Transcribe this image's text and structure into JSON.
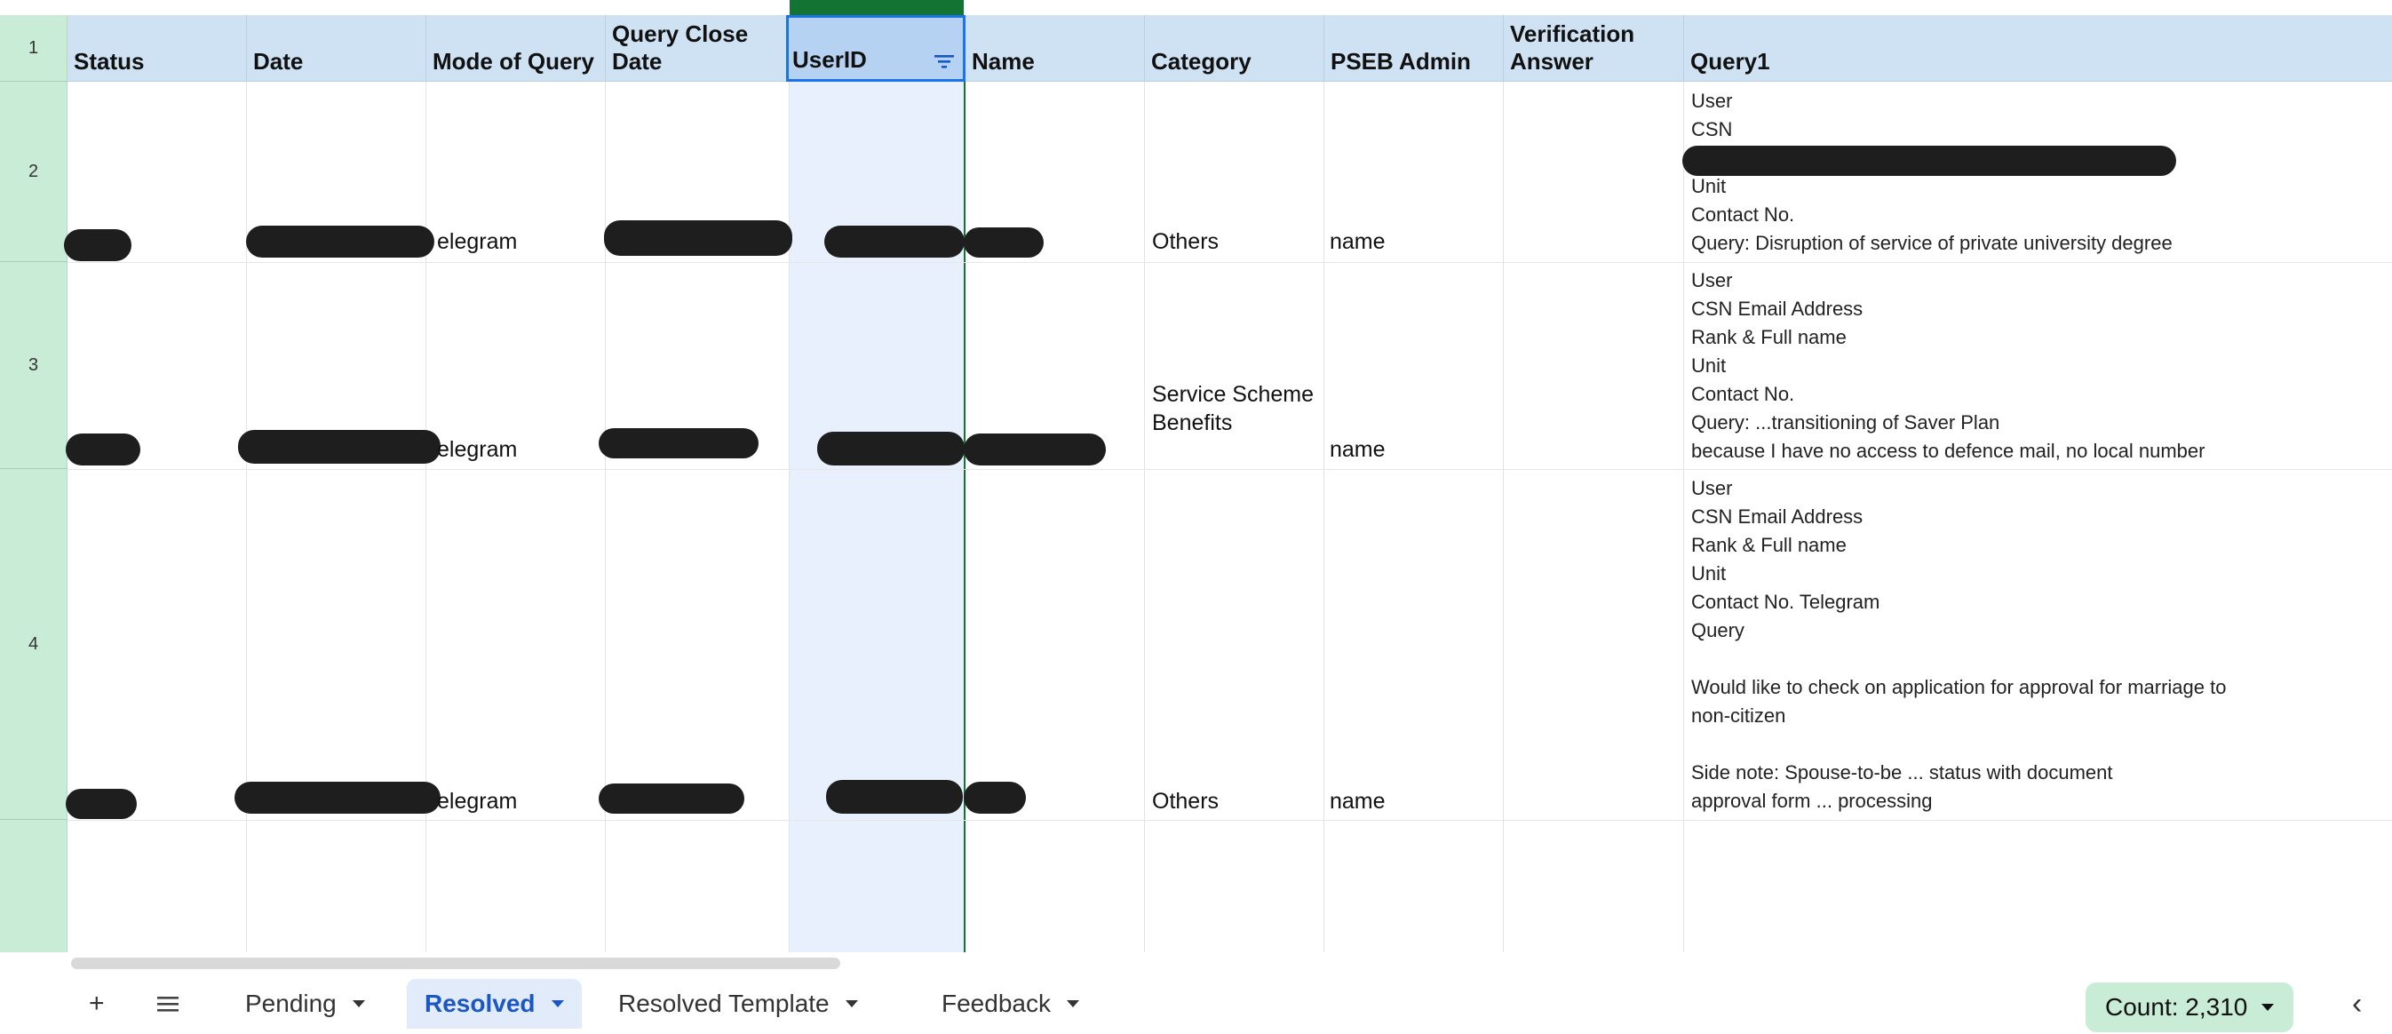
{
  "columns": [
    {
      "label": "Status"
    },
    {
      "label": "Date"
    },
    {
      "label": "Mode of Query"
    },
    {
      "label": "Query Close Date"
    },
    {
      "label": "UserID"
    },
    {
      "label": "Name"
    },
    {
      "label": "Category"
    },
    {
      "label": "PSEB Admin"
    },
    {
      "label": "Verification Answer"
    },
    {
      "label": "Query1"
    }
  ],
  "row_numbers": [
    "1",
    "2",
    "3",
    "4"
  ],
  "rows": [
    {
      "mode": "elegram",
      "category": "Others",
      "admin": "name",
      "query_lines": [
        "User",
        "CSN",
        "Unit",
        "Contact No.",
        "Query: Disruption of service of private university degree"
      ]
    },
    {
      "mode": "elegram",
      "category": "Service Scheme Benefits",
      "admin": "name",
      "query_lines": [
        "User",
        "CSN Email Address",
        "Rank & Full name",
        "Unit",
        "Contact No.",
        "Query: ...transitioning of Saver Plan",
        "because I have no access to defence mail, no local number"
      ]
    },
    {
      "mode": "elegram",
      "category": "Others",
      "admin": "name",
      "query_lines": [
        "User",
        "CSN Email Address",
        "Rank & Full name",
        "Unit",
        "Contact No. Telegram",
        "Query",
        "",
        "Would like to check on application for approval for marriage to",
        "non-citizen",
        "",
        "Side note: Spouse-to-be ... status with document",
        "approval form ... processing"
      ]
    }
  ],
  "filter": {
    "column": "UserID",
    "icon": "filter-icon"
  },
  "tabs": {
    "add_label": "+",
    "menu_icon": "sheets-menu-icon",
    "items": [
      {
        "label": "Pending",
        "active": false
      },
      {
        "label": "Resolved",
        "active": true
      },
      {
        "label": "Resolved Template",
        "active": false
      },
      {
        "label": "Feedback",
        "active": false
      }
    ]
  },
  "status_bar": {
    "count": "Count: 2,310"
  },
  "colors": {
    "accent": "#1a73e8",
    "header_bg": "#cfe2f3",
    "row_header_bg": "#c9ecd6",
    "selection_bg": "#e7f0fc",
    "active_tab": "#1a56c4"
  }
}
